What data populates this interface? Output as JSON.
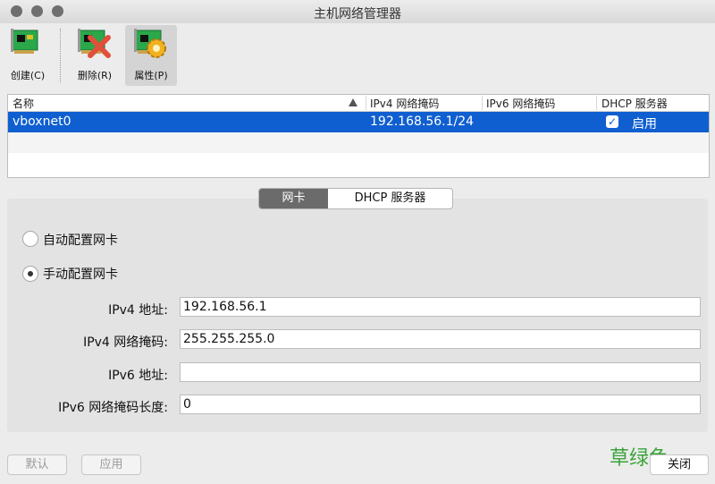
{
  "window": {
    "title": "主机网络管理器"
  },
  "toolbar": {
    "create": "创建(C)",
    "delete": "删除(R)",
    "properties": "属性(P)"
  },
  "table": {
    "headers": [
      "名称",
      "IPv4 网络掩码",
      "IPv6 网络掩码",
      "DHCP 服务器"
    ],
    "rows": [
      {
        "name": "vboxnet0",
        "ipv4": "192.168.56.1/24",
        "ipv6": "",
        "dhcp_checked": true,
        "dhcp_label": "启用"
      }
    ]
  },
  "tabs": {
    "adapter": "网卡",
    "dhcp": "DHCP 服务器"
  },
  "config": {
    "auto": "自动配置网卡",
    "manual": "手动配置网卡",
    "selected": "manual"
  },
  "fields": {
    "ipv4_addr_label": "IPv4 地址:",
    "ipv4_addr": "192.168.56.1",
    "ipv4_mask_label": "IPv4 网络掩码:",
    "ipv4_mask": "255.255.255.0",
    "ipv6_addr_label": "IPv6 地址:",
    "ipv6_addr": "",
    "ipv6_prefix_label": "IPv6 网络掩码长度:",
    "ipv6_prefix": "0"
  },
  "buttons": {
    "reset": "默认",
    "apply": "应用",
    "close": "关闭"
  },
  "watermark": "草绿色",
  "icons": {
    "create": "network-card-add-icon",
    "delete": "network-card-remove-icon",
    "properties": "network-card-settings-icon",
    "check": "checkmark-icon"
  }
}
